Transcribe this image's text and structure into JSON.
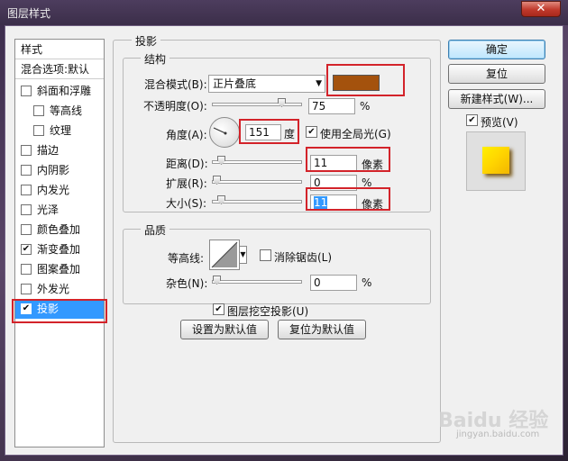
{
  "window": {
    "title": "图层样式",
    "close_glyph": "✕"
  },
  "style_list": {
    "header": "样式",
    "blend_default": "混合选项:默认",
    "items": [
      {
        "label": "斜面和浮雕",
        "checked": false
      },
      {
        "label": "等高线",
        "checked": false
      },
      {
        "label": "纹理",
        "checked": false
      },
      {
        "label": "描边",
        "checked": false
      },
      {
        "label": "内阴影",
        "checked": false
      },
      {
        "label": "内发光",
        "checked": false
      },
      {
        "label": "光泽",
        "checked": false
      },
      {
        "label": "颜色叠加",
        "checked": false
      },
      {
        "label": "渐变叠加",
        "checked": true
      },
      {
        "label": "图案叠加",
        "checked": false
      },
      {
        "label": "外发光",
        "checked": false
      },
      {
        "label": "投影",
        "checked": true,
        "selected": true
      }
    ]
  },
  "drop_shadow": {
    "section_title": "投影",
    "structure": {
      "title": "结构",
      "blend_mode_label": "混合模式(B):",
      "blend_mode_value": "正片叠底",
      "shadow_color": "#a4520d",
      "opacity_label": "不透明度(O):",
      "opacity_value": "75",
      "opacity_unit": "%",
      "angle_label": "角度(A):",
      "angle_value": "151",
      "angle_unit": "度",
      "global_light_label": "使用全局光(G)",
      "global_light_checked": true,
      "distance_label": "距离(D):",
      "distance_value": "11",
      "distance_unit": "像素",
      "spread_label": "扩展(R):",
      "spread_value": "0",
      "spread_unit": "%",
      "size_label": "大小(S):",
      "size_value": "11",
      "size_unit": "像素"
    },
    "quality": {
      "title": "品质",
      "contour_label": "等高线:",
      "antialias_label": "消除锯齿(L)",
      "antialias_checked": false,
      "noise_label": "杂色(N):",
      "noise_value": "0",
      "noise_unit": "%"
    },
    "knockout_label": "图层挖空投影(U)",
    "knockout_checked": true,
    "make_default_label": "设置为默认值",
    "reset_default_label": "复位为默认值"
  },
  "buttons": {
    "ok": "确定",
    "reset": "复位",
    "new_style": "新建样式(W)...",
    "preview_label": "预览(V)",
    "preview_checked": true
  },
  "watermark": {
    "text": "Baidu 经验",
    "subtext": "jingyan.baidu.com"
  }
}
